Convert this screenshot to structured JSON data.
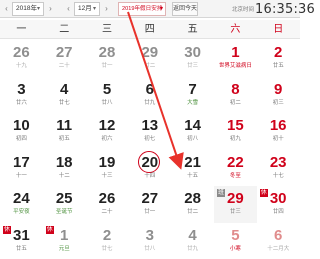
{
  "toolbar": {
    "prev_label": "‹",
    "next_label": "›",
    "year_label": "2018年",
    "month_label": "12月",
    "holiday_label": "2019年假日安排",
    "today_label": "返回今天",
    "clock_caption": "北京时间",
    "clock_time": "16:35:36",
    "accent_color": "#d0021b"
  },
  "weekdays": [
    "一",
    "二",
    "三",
    "四",
    "五",
    "六",
    "日"
  ],
  "weeks": [
    [
      {
        "day": "26",
        "lunar": "十九",
        "other": true
      },
      {
        "day": "27",
        "lunar": "二十",
        "other": true
      },
      {
        "day": "28",
        "lunar": "廿一",
        "other": true
      },
      {
        "day": "29",
        "lunar": "廿二",
        "other": true
      },
      {
        "day": "30",
        "lunar": "廿三",
        "other": true
      },
      {
        "day": "1",
        "lunar": "世界艾滋病日",
        "festival": true
      },
      {
        "day": "2",
        "lunar": "廿五"
      }
    ],
    [
      {
        "day": "3",
        "lunar": "廿六"
      },
      {
        "day": "4",
        "lunar": "廿七"
      },
      {
        "day": "5",
        "lunar": "廿八"
      },
      {
        "day": "6",
        "lunar": "廿九"
      },
      {
        "day": "7",
        "lunar": "大雪",
        "festival": true
      },
      {
        "day": "8",
        "lunar": "初二"
      },
      {
        "day": "9",
        "lunar": "初三"
      }
    ],
    [
      {
        "day": "10",
        "lunar": "初四"
      },
      {
        "day": "11",
        "lunar": "初五"
      },
      {
        "day": "12",
        "lunar": "初六"
      },
      {
        "day": "13",
        "lunar": "初七"
      },
      {
        "day": "14",
        "lunar": "初八"
      },
      {
        "day": "15",
        "lunar": "初九"
      },
      {
        "day": "16",
        "lunar": "初十"
      }
    ],
    [
      {
        "day": "17",
        "lunar": "十一"
      },
      {
        "day": "18",
        "lunar": "十二"
      },
      {
        "day": "19",
        "lunar": "十三"
      },
      {
        "day": "20",
        "lunar": "十四",
        "today": true
      },
      {
        "day": "21",
        "lunar": "十五"
      },
      {
        "day": "22",
        "lunar": "冬至",
        "festival": true
      },
      {
        "day": "23",
        "lunar": "十七"
      }
    ],
    [
      {
        "day": "24",
        "lunar": "平安夜",
        "festival": true
      },
      {
        "day": "25",
        "lunar": "圣诞节",
        "festival": true
      },
      {
        "day": "26",
        "lunar": "二十"
      },
      {
        "day": "27",
        "lunar": "廿一"
      },
      {
        "day": "28",
        "lunar": "廿二"
      },
      {
        "day": "29",
        "lunar": "廿三",
        "badge": "班",
        "badge_type": "work"
      },
      {
        "day": "30",
        "lunar": "廿四",
        "badge": "休",
        "badge_type": "rest"
      }
    ],
    [
      {
        "day": "31",
        "lunar": "廿五",
        "badge": "休",
        "badge_type": "rest"
      },
      {
        "day": "1",
        "lunar": "元旦",
        "other": true,
        "festival": true,
        "badge": "休",
        "badge_type": "rest"
      },
      {
        "day": "2",
        "lunar": "廿七",
        "other": true
      },
      {
        "day": "3",
        "lunar": "廿八",
        "other": true
      },
      {
        "day": "4",
        "lunar": "廿九",
        "other": true
      },
      {
        "day": "5",
        "lunar": "小寒",
        "other": true,
        "festival": true
      },
      {
        "day": "6",
        "lunar": "十二月大",
        "other": true
      }
    ]
  ]
}
